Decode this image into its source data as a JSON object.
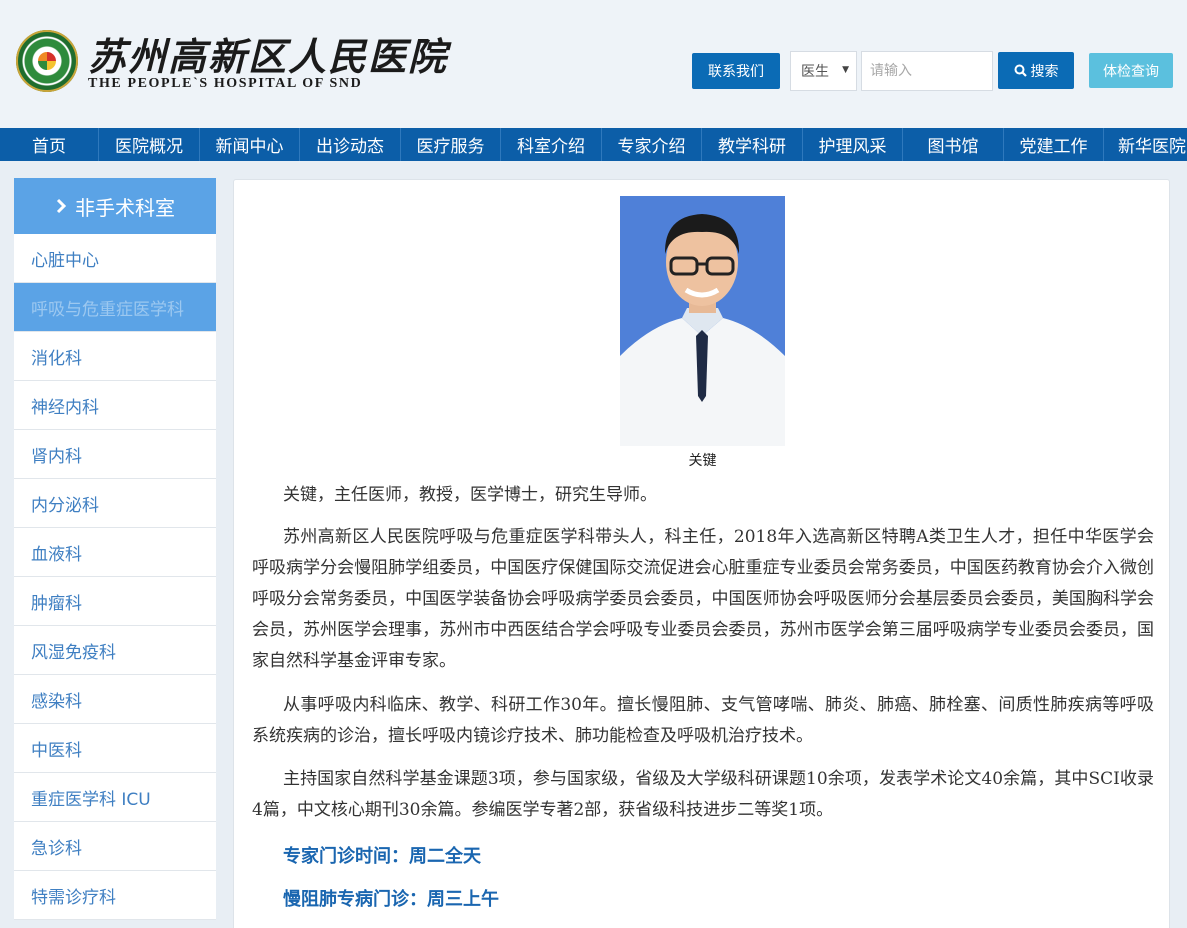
{
  "header": {
    "logo_cn": "苏州高新区人民医院",
    "logo_en": "THE PEOPLE`S HOSPITAL OF SND",
    "contact_label": "联系我们",
    "select_value": "医生",
    "search_placeholder": "请输入",
    "search_label": "搜索",
    "checkup_label": "体检查询"
  },
  "nav": {
    "items": [
      "首页",
      "医院概况",
      "新闻中心",
      "出诊动态",
      "医疗服务",
      "科室介绍",
      "专家介绍",
      "教学科研",
      "护理风采",
      "图书馆",
      "党建工作",
      "新华医院"
    ]
  },
  "sidebar": {
    "title": "非手术科室",
    "items": [
      "心脏中心",
      "呼吸与危重症医学科",
      "消化科",
      "神经内科",
      "肾内科",
      "内分泌科",
      "血液科",
      "肿瘤科",
      "风湿免疫科",
      "感染科",
      "中医科",
      "重症医学科 ICU",
      "急诊科",
      "特需诊疗科"
    ],
    "active_index": 1
  },
  "doctor": {
    "name": "关键",
    "intro": "关键，主任医师，教授，医学博士，研究生导师。",
    "p2": "苏州高新区人民医院呼吸与危重症医学科带头人，科主任，2018年入选高新区特聘A类卫生人才，担任中华医学会呼吸病学分会慢阻肺学组委员，中国医疗保健国际交流促进会心脏重症专业委员会常务委员，中国医药教育协会介入微创呼吸分会常务委员，中国医学装备协会呼吸病学委员会委员，中国医师协会呼吸医师分会基层委员会委员，美国胸科学会会员，苏州医学会理事，苏州市中西医结合学会呼吸专业委员会委员，苏州市医学会第三届呼吸病学专业委员会委员，国家自然科学基金评审专家。",
    "p3": "从事呼吸内科临床、教学、科研工作30年。擅长慢阻肺、支气管哮喘、肺炎、肺癌、肺栓塞、间质性肺疾病等呼吸系统疾病的诊治，擅长呼吸内镜诊疗技术、肺功能检查及呼吸机治疗技术。",
    "p4": "主持国家自然科学基金课题3项，参与国家级，省级及大学级科研课题10余项，发表学术论文40余篇，其中SCI收录4篇，中文核心期刊30余篇。参编医学专著2部，获省级科技进步二等奖1项。",
    "clinic_time": "专家门诊时间：周二全天",
    "copd_clinic": "慢阻肺专病门诊：周三上午"
  }
}
